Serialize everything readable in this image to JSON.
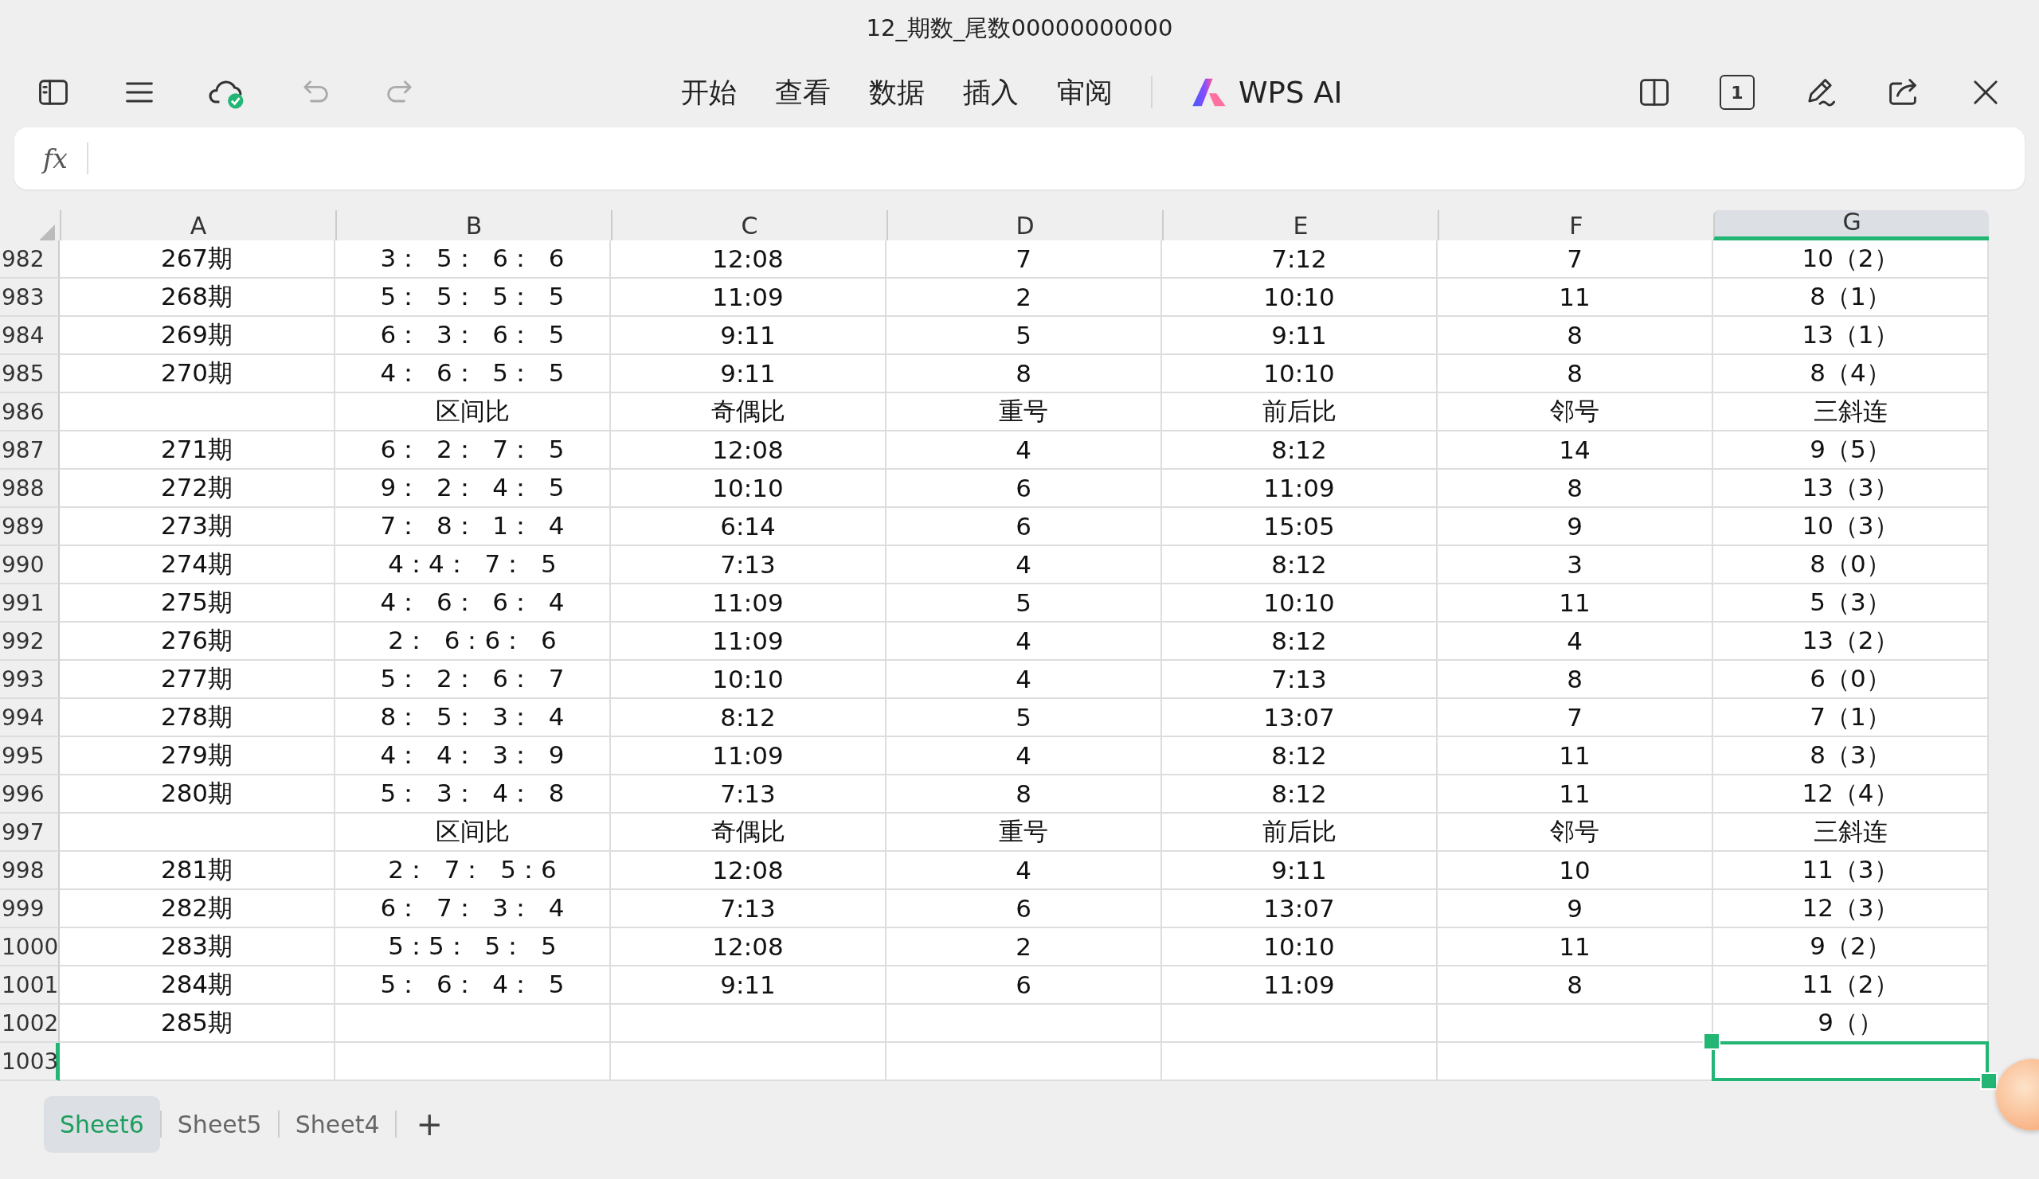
{
  "window": {
    "title": "12_期数_尾数00000000000"
  },
  "toolbar": {
    "menu": [
      {
        "label": "开始"
      },
      {
        "label": "查看"
      },
      {
        "label": "数据"
      },
      {
        "label": "插入"
      },
      {
        "label": "审阅"
      }
    ],
    "ai_label": "WPS AI",
    "undo_disabled": true,
    "redo_disabled": true,
    "page_count": "1"
  },
  "formula_bar": {
    "label": "fx"
  },
  "sheet": {
    "columns": [
      {
        "label": "A",
        "selected": false
      },
      {
        "label": "B",
        "selected": false
      },
      {
        "label": "C",
        "selected": false
      },
      {
        "label": "D",
        "selected": false
      },
      {
        "label": "E",
        "selected": false
      },
      {
        "label": "F",
        "selected": false
      },
      {
        "label": "G",
        "selected": true
      }
    ],
    "rows": [
      {
        "number": "982",
        "selected": false,
        "cells": {
          "A": "267期",
          "B": "3：  5：  6：  6",
          "C": "12:08",
          "D": "7",
          "E": "7:12",
          "F": "7",
          "G": "10（2）"
        }
      },
      {
        "number": "983",
        "selected": false,
        "cells": {
          "A": "268期",
          "B": "5：  5：  5：  5",
          "C": "11:09",
          "D": "2",
          "E": "10:10",
          "F": "11",
          "G": "8（1）"
        }
      },
      {
        "number": "984",
        "selected": false,
        "cells": {
          "A": "269期",
          "B": "6：  3：  6：  5",
          "C": "9:11",
          "D": "5",
          "E": "9:11",
          "F": "8",
          "G": "13（1）"
        }
      },
      {
        "number": "985",
        "selected": false,
        "cells": {
          "A": "270期",
          "B": "4：  6：  5：  5",
          "C": "9:11",
          "D": "8",
          "E": "10:10",
          "F": "8",
          "G": "8（4）"
        }
      },
      {
        "number": "986",
        "selected": false,
        "cells": {
          "B": "区间比",
          "C": "奇偶比",
          "D": "重号",
          "E": "前后比",
          "F": "邻号",
          "G": "三斜连"
        }
      },
      {
        "number": "987",
        "selected": false,
        "cells": {
          "A": "271期",
          "B": "6：  2：  7：  5",
          "C": "12:08",
          "D": "4",
          "E": "8:12",
          "F": "14",
          "G": "9（5）"
        }
      },
      {
        "number": "988",
        "selected": false,
        "cells": {
          "A": "272期",
          "B": "9：  2：  4：  5",
          "C": "10:10",
          "D": "6",
          "E": "11:09",
          "F": "8",
          "G": "13（3）"
        }
      },
      {
        "number": "989",
        "selected": false,
        "cells": {
          "A": "273期",
          "B": "7：  8：  1：  4",
          "C": "6:14",
          "D": "6",
          "E": "15:05",
          "F": "9",
          "G": "10（3）"
        }
      },
      {
        "number": "990",
        "selected": false,
        "cells": {
          "A": "274期",
          "B": "4：4：  7：  5",
          "C": "7:13",
          "D": "4",
          "E": "8:12",
          "F": "3",
          "G": "8（0）"
        }
      },
      {
        "number": "991",
        "selected": false,
        "cells": {
          "A": "275期",
          "B": "4：  6：  6：  4",
          "C": "11:09",
          "D": "5",
          "E": "10:10",
          "F": "11",
          "G": "5（3）"
        }
      },
      {
        "number": "992",
        "selected": false,
        "cells": {
          "A": "276期",
          "B": "2：  6：6：  6",
          "C": "11:09",
          "D": "4",
          "E": "8:12",
          "F": "4",
          "G": "13（2）"
        }
      },
      {
        "number": "993",
        "selected": false,
        "cells": {
          "A": "277期",
          "B": "5：  2：  6：  7",
          "C": "10:10",
          "D": "4",
          "E": "7:13",
          "F": "8",
          "G": "6（0）"
        }
      },
      {
        "number": "994",
        "selected": false,
        "cells": {
          "A": "278期",
          "B": "8：  5：  3：  4",
          "C": "8:12",
          "D": "5",
          "E": "13:07",
          "F": "7",
          "G": "7（1）"
        }
      },
      {
        "number": "995",
        "selected": false,
        "cells": {
          "A": "279期",
          "B": "4：  4：  3：  9",
          "C": "11:09",
          "D": "4",
          "E": "8:12",
          "F": "11",
          "G": "8（3）"
        }
      },
      {
        "number": "996",
        "selected": false,
        "cells": {
          "A": "280期",
          "B": "5：  3：  4：  8",
          "C": "7:13",
          "D": "8",
          "E": "8:12",
          "F": "11",
          "G": "12（4）"
        }
      },
      {
        "number": "997",
        "selected": false,
        "cells": {
          "B": "区间比",
          "C": "奇偶比",
          "D": "重号",
          "E": "前后比",
          "F": "邻号",
          "G": "三斜连"
        }
      },
      {
        "number": "998",
        "selected": false,
        "cells": {
          "A": "281期",
          "B": "2：  7：  5：6",
          "C": "12:08",
          "D": "4",
          "E": "9:11",
          "F": "10",
          "G": "11（3）"
        }
      },
      {
        "number": "999",
        "selected": false,
        "cells": {
          "A": "282期",
          "B": "6：  7：  3：  4",
          "C": "7:13",
          "D": "6",
          "E": "13:07",
          "F": "9",
          "G": "12（3）"
        }
      },
      {
        "number": "1000",
        "selected": false,
        "cells": {
          "A": "283期",
          "B": "5：5：  5：  5",
          "C": "12:08",
          "D": "2",
          "E": "10:10",
          "F": "11",
          "G": "9（2）"
        }
      },
      {
        "number": "1001",
        "selected": false,
        "cells": {
          "A": "284期",
          "B": "5：  6：  4：  5",
          "C": "9:11",
          "D": "6",
          "E": "11:09",
          "F": "8",
          "G": "11（2）"
        }
      },
      {
        "number": "1002",
        "selected": false,
        "cells": {
          "A": "285期",
          "G": "9（）"
        }
      },
      {
        "number": "1003",
        "selected": true,
        "cells": {}
      }
    ]
  },
  "sheet_tabs": [
    {
      "label": "Sheet6",
      "selected": true
    },
    {
      "label": "Sheet5",
      "selected": false
    },
    {
      "label": "Sheet4",
      "selected": false
    }
  ],
  "add_sheet": "+"
}
